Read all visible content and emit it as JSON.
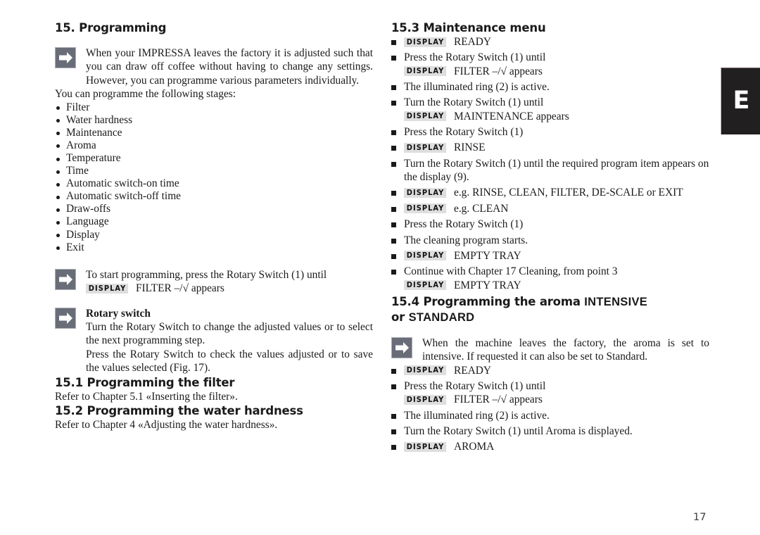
{
  "document": {
    "page_number": "17",
    "edge_tab_label": "E",
    "display_badge_label": "DISPLAY",
    "arrow_icon": "arrow-right-icon",
    "colors": {
      "text": "#1a1a1a",
      "arrow_box": "#696d78",
      "badge_bg": "#dededf",
      "edge_tab_bg": "#211f20"
    }
  },
  "left_column": {
    "heading": "15. Programming",
    "intro_note": "When your IMPRESSA leaves the factory it is adjusted such that you can draw off coffee without having to change any settings. However, you can programme various parameters individually.",
    "stages_lead": "You can programme the following stages:",
    "stages": [
      "Filter",
      "Water hardness",
      "Maintenance",
      "Aroma",
      "Temperature",
      "Time",
      "Automatic switch-on time",
      "Automatic switch-off time",
      "Draw-offs",
      "Language",
      "Display",
      "Exit"
    ],
    "start_note": {
      "line1": "To start programming, press the Rotary Switch (1) until",
      "badge": "DISPLAY",
      "line2_pre": "FILTER ",
      "line2_tick": "–/√",
      "line2_post": " appears"
    },
    "rotary_note": {
      "title": "Rotary switch",
      "paragraph1": "Turn the Rotary Switch to change the adjusted values or to select the next programming step.",
      "paragraph2": "Press the Rotary Switch to check the values adjusted or to save the values selected (Fig. 17)."
    },
    "section_15_1": {
      "heading": "15.1 Programming the filter",
      "body": "Refer to Chapter 5.1 «Inserting the filter»."
    },
    "section_15_2": {
      "heading": "15.2 Programming the water hardness",
      "body": "Refer to Chapter 4 «Adjusting the water hardness»."
    }
  },
  "right_column": {
    "section_15_3": {
      "heading": "15.3 Maintenance menu",
      "steps": [
        {
          "badge": "DISPLAY",
          "text": "READY"
        },
        {
          "text": "Press the Rotary Switch (1) until",
          "sub_badge": "DISPLAY",
          "sub_pre": "FILTER ",
          "sub_tick": "–/√",
          "sub_post": " appears"
        },
        {
          "text": "The illuminated ring (2) is active."
        },
        {
          "text": "Turn the Rotary Switch (1) until",
          "sub_badge": "DISPLAY",
          "sub_text": "MAINTENANCE appears"
        },
        {
          "text": "Press the Rotary Switch (1)"
        },
        {
          "badge": "DISPLAY",
          "text": "RINSE"
        },
        {
          "text": "Turn the Rotary Switch (1) until the required program item appears on the display (9)."
        },
        {
          "badge": "DISPLAY",
          "text": "e.g. RINSE, CLEAN, FILTER, DE-SCALE or EXIT"
        },
        {
          "badge": "DISPLAY",
          "text": "e.g. CLEAN"
        },
        {
          "text": "Press the Rotary Switch (1)"
        },
        {
          "text": "The cleaning program starts."
        },
        {
          "badge": "DISPLAY",
          "text": "EMPTY TRAY"
        },
        {
          "text": "Continue with Chapter 17 Cleaning, from point 3",
          "sub_badge": "DISPLAY",
          "sub_text": "EMPTY TRAY"
        }
      ]
    },
    "section_15_4": {
      "heading_line1_normal": "15.4 Programming the aroma ",
      "heading_line1_wide": "INTENSIVE",
      "heading_line2_normal": "or ",
      "heading_line2_wide": "STANDARD",
      "note": "When the machine leaves the factory, the aroma is set to intensive. If requested it can also be set to Standard.",
      "steps": [
        {
          "badge": "DISPLAY",
          "text": "READY"
        },
        {
          "text": "Press the Rotary Switch (1) until",
          "sub_badge": "DISPLAY",
          "sub_pre": "FILTER ",
          "sub_tick": "–/√",
          "sub_post": " appears"
        },
        {
          "text": "The illuminated ring (2) is active."
        },
        {
          "text": "Turn the Rotary Switch (1) until Aroma is displayed."
        },
        {
          "badge": "DISPLAY",
          "text": "AROMA"
        }
      ]
    }
  }
}
